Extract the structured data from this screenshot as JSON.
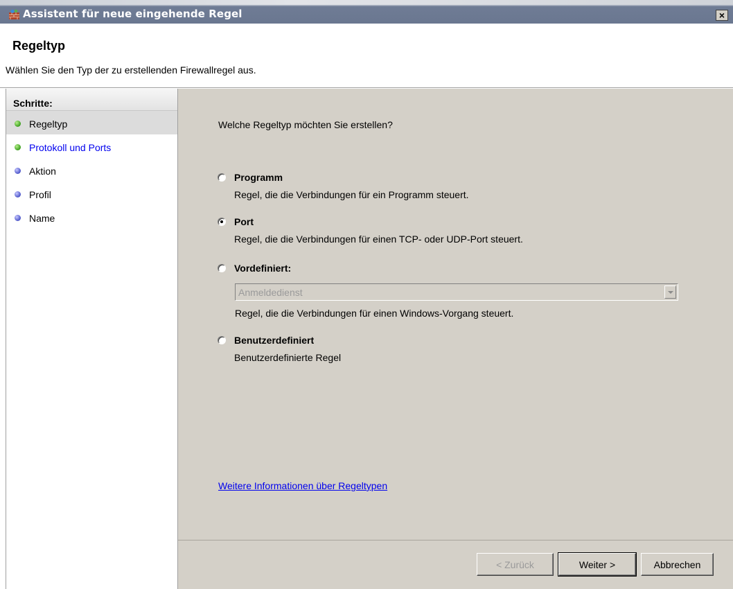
{
  "window": {
    "title": "Assistent für neue eingehende Regel",
    "close_symbol": "×",
    "icon": "firewall-brick-icon"
  },
  "header": {
    "title": "Regeltyp",
    "subtitle": "Wählen Sie den Typ der zu erstellenden Firewallregel aus."
  },
  "steps": {
    "heading": "Schritte:",
    "items": [
      {
        "label": "Regeltyp",
        "state": "active",
        "dot": "green"
      },
      {
        "label": "Protokoll und Ports",
        "state": "link",
        "dot": "green"
      },
      {
        "label": "Aktion",
        "state": "normal",
        "dot": "blue"
      },
      {
        "label": "Profil",
        "state": "normal",
        "dot": "blue"
      },
      {
        "label": "Name",
        "state": "normal",
        "dot": "blue"
      }
    ]
  },
  "main": {
    "question": "Welche Regeltyp möchten Sie erstellen?",
    "options": [
      {
        "label": "Programm",
        "description": "Regel, die die Verbindungen für ein Programm steuert.",
        "selected": false
      },
      {
        "label": "Port",
        "description": "Regel, die die Verbindungen für einen TCP- oder UDP-Port steuert.",
        "selected": true
      },
      {
        "label": "Vordefiniert:",
        "description": "",
        "selected": false
      },
      {
        "label": "Benutzerdefiniert",
        "description": "Benutzerdefinierte Regel",
        "selected": false
      }
    ],
    "predefined_combo": {
      "value": "Anmeldedienst",
      "enabled": false,
      "description": "Regel, die die Verbindungen für einen Windows-Vorgang steuert."
    },
    "info_link": "Weitere Informationen über Regeltypen"
  },
  "buttons": {
    "back": "< Zurück",
    "next": "Weiter >",
    "cancel": "Abbrechen"
  }
}
